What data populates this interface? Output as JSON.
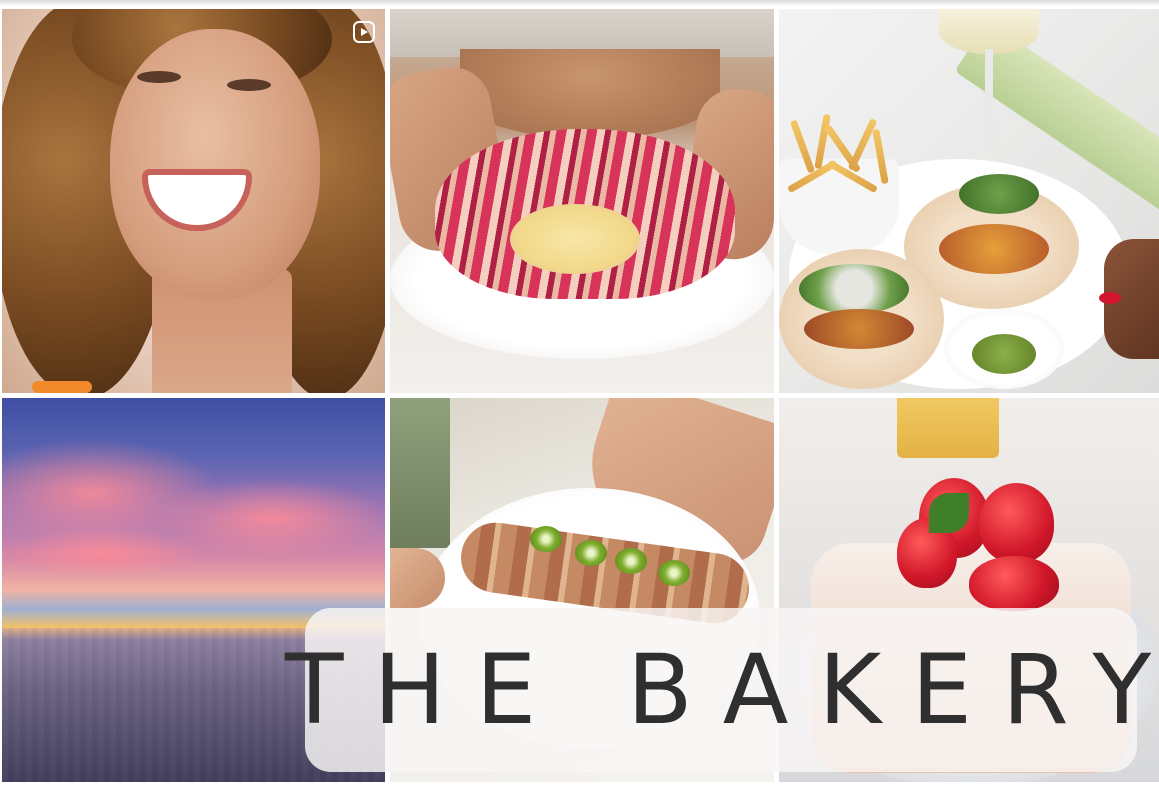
{
  "banner": {
    "title": "THE BAKERY"
  },
  "posts": [
    {
      "icon": "reel-icon"
    },
    {},
    {},
    {},
    {},
    {}
  ],
  "colors": {
    "banner_background": "#f8f6f4",
    "banner_text": "#2f2f2f",
    "reel_icon": "#ffffff"
  }
}
